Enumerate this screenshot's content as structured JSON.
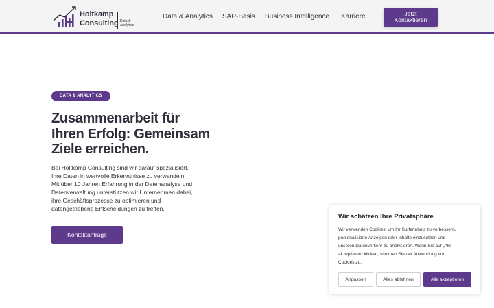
{
  "brand": {
    "name_line1": "Holtkamp",
    "name_line2": "Consulting",
    "tag_line1": "Data &",
    "tag_line2": "Analytics",
    "accent_color": "#5d3a8c"
  },
  "nav": {
    "items": [
      {
        "label": "Data & Analytics"
      },
      {
        "label": "SAP-Basis"
      },
      {
        "label": "Business Intelligence"
      },
      {
        "label": "Karriere"
      }
    ],
    "cta_line1": "Jetzt",
    "cta_line2": "Kontaktieren"
  },
  "hero": {
    "badge": "DATA & ANALYTICS",
    "title_lines": [
      "Zusammenarbeit für",
      "Ihren Erfolg: Gemeinsam",
      "Ziele erreichen."
    ],
    "text_lines": [
      "Bei Holtkamp Consulting sind wir darauf spezialisiert,",
      "Ihre Daten in wertvolle Erkenntnisse zu verwandeln.",
      "Mit über 10 Jahren Erfahrung in der Datenanalyse und",
      "Datenverwaltung unterstützen wir Unternehmen dabei,",
      "ihre Geschäftsprozesse zu optimieren und",
      "datengetriebene Entscheidungen zu treffen."
    ],
    "button_label": "Kontaktanfrage"
  },
  "cookie": {
    "title": "Wir schätzen Ihre Privatsphäre",
    "text_lines": [
      "Wir verwenden Cookies, um Ihr Surferlebnis zu verbessern,",
      "personalisierte Anzeigen oder Inhalte einzusetzen und",
      "unseren Datenverkehr zu analysieren. Wenn Sie auf „Alle",
      "akzeptieren“ klicken, stimmen Sie der Anwendung von",
      "Cookies zu."
    ],
    "customize_label": "Anpassen",
    "reject_label": "Alles ablehnen",
    "accept_label": "Alle akzeptieren"
  }
}
